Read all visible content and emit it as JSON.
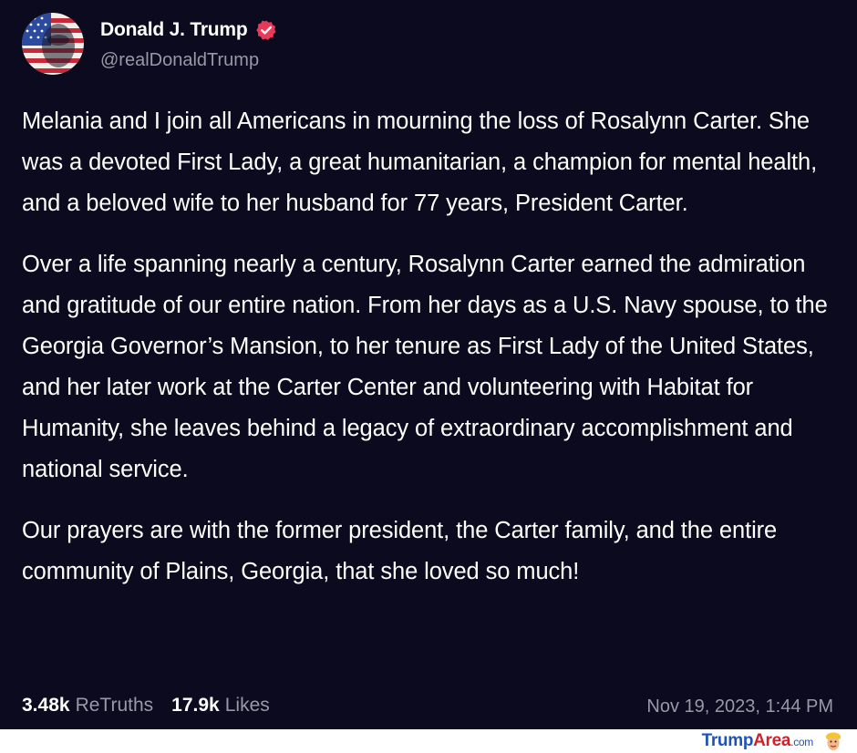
{
  "author": {
    "display_name": "Donald J. Trump",
    "handle": "@realDonaldTrump",
    "verified": true,
    "verified_color": "#e8395a"
  },
  "post": {
    "paragraphs": [
      "Melania and I join all Americans in mourning the loss of Rosalynn Carter. She was a devoted First Lady, a great humanitarian, a champion for mental health, and a beloved wife to her husband for 77 years, President Carter.",
      "Over a life spanning nearly a century, Rosalynn Carter earned the admiration and gratitude of our entire nation. From her days as a U.S. Navy spouse, to the Georgia Governor’s Mansion, to her tenure as First Lady of the United States, and her later work at the Carter Center and volunteering with Habitat for Humanity, she leaves behind a legacy of extraordinary accomplishment and national service.",
      "Our prayers are with the former president, the Carter family, and the entire community of Plains, Georgia, that she loved so much!"
    ],
    "retruths_count": "3.48k",
    "retruths_label": "ReTruths",
    "likes_count": "17.9k",
    "likes_label": "Likes",
    "timestamp": "Nov 19, 2023, 1:44 PM"
  },
  "watermark": {
    "part1": "Trump",
    "part2": "Area",
    "part3": ".com",
    "icon": "trump-cartoon-icon"
  },
  "colors": {
    "background": "#0c0a1e",
    "secondary_text": "#9a97a6",
    "brand_blue": "#1d53b8",
    "brand_red": "#d1202a"
  }
}
